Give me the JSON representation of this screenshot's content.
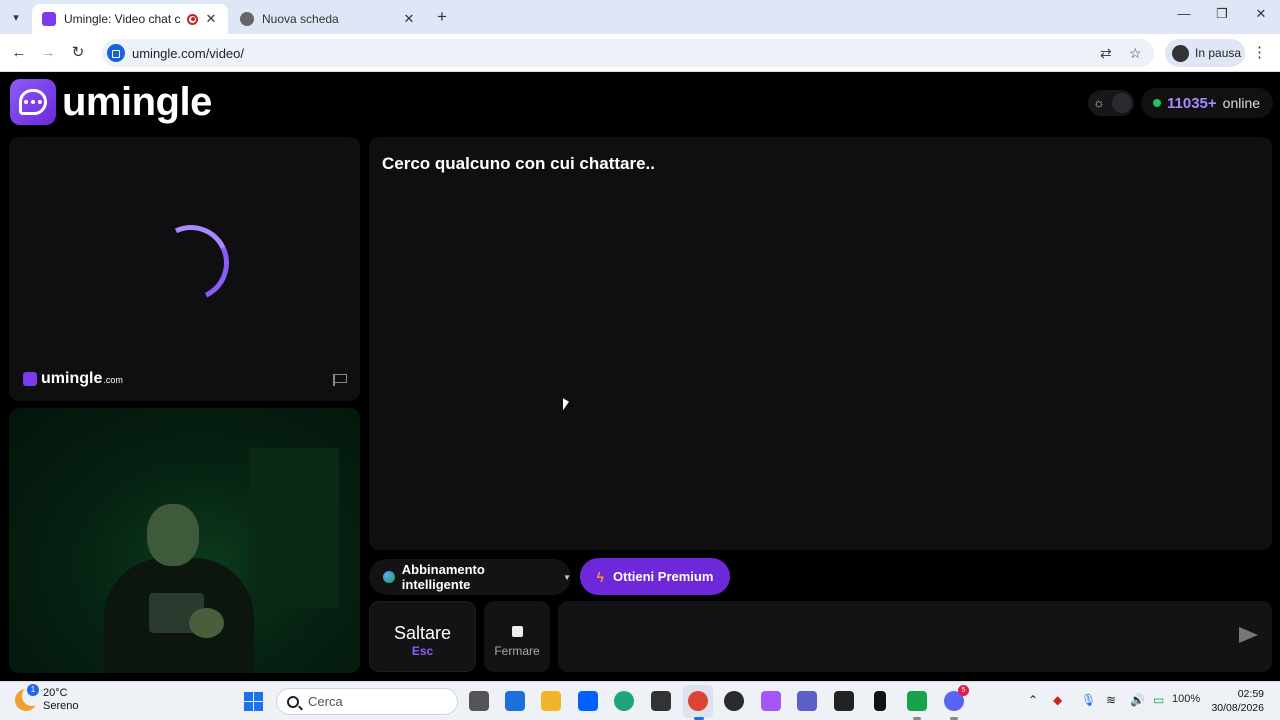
{
  "browser": {
    "tabs": [
      {
        "title": "Umingle: Video chat con sc",
        "active": true
      },
      {
        "title": "Nuova scheda",
        "active": false
      }
    ],
    "url": "umingle.com/video/",
    "profile_label": "In pausa"
  },
  "header": {
    "logo_text": "umingle",
    "online_count": "11035+",
    "online_label": "online"
  },
  "stranger_video": {
    "watermark_text": "umingle",
    "watermark_suffix": ".com"
  },
  "chat": {
    "status_text": "Cerco qualcuno con cui chattare..",
    "message_placeholder": ""
  },
  "controls": {
    "match_label": "Abbinamento intelligente",
    "premium_label": "Ottieni Premium",
    "skip_label": "Saltare",
    "skip_key": "Esc",
    "stop_label": "Fermare"
  },
  "taskbar": {
    "weather_temp": "20°C",
    "weather_desc": "Sereno",
    "weather_badge": "1",
    "search_label": "Cerca",
    "discord_badge": "5",
    "battery": "100%",
    "time": "02:59",
    "date": "30/08/2026"
  },
  "colors": {
    "accent": "#7c3aed",
    "online_dot": "#22c55e",
    "premium_bg": "#6d28d9"
  }
}
